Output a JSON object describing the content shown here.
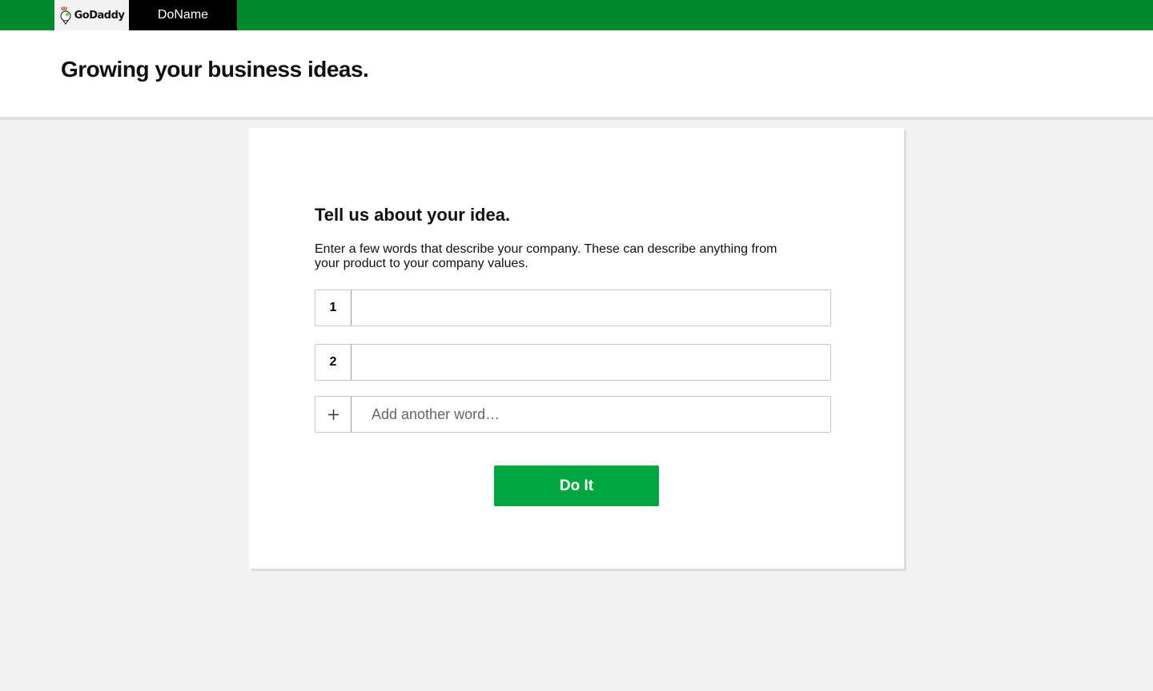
{
  "header": {
    "logo_text": "GoDaddy",
    "brand": "DoName"
  },
  "hero": {
    "title": "Growing your business ideas."
  },
  "form": {
    "title": "Tell us about your idea.",
    "description": "Enter a few words that describe your company. These can describe anything from your product to your company values.",
    "fields": [
      {
        "label": "1",
        "value": ""
      },
      {
        "label": "2",
        "value": ""
      }
    ],
    "add_placeholder": "Add another word…",
    "submit_label": "Do It"
  },
  "colors": {
    "topbar": "#008a2e",
    "button": "#00a63f"
  }
}
